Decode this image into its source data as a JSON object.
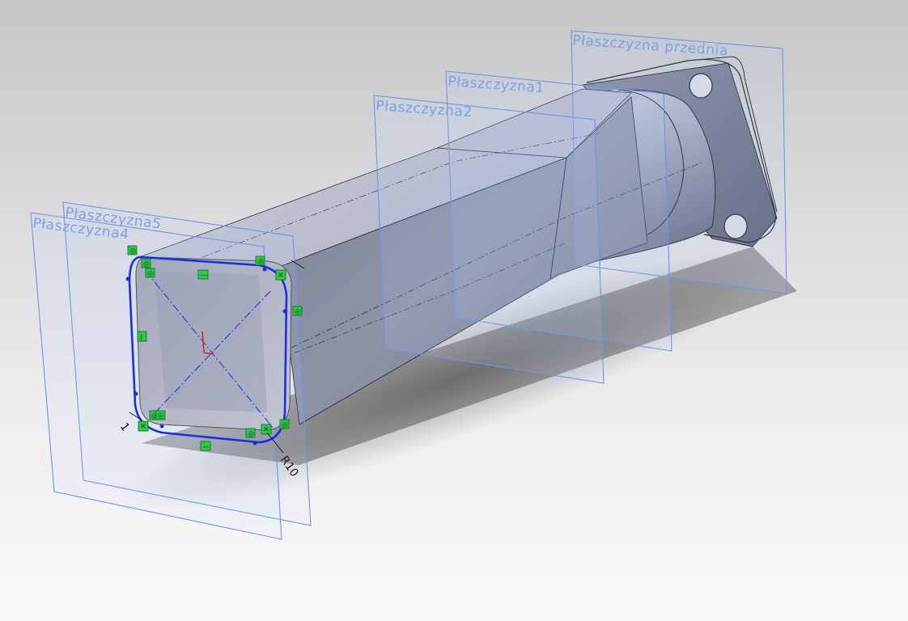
{
  "viewport": {
    "background_top": "#c4c6c8",
    "background_bottom": "#fafafa",
    "model_color": "#9ea3b5",
    "plane_color": "#6f93ea",
    "sketch_color": "#1a2fe0",
    "relation_color": "#2dc84a"
  },
  "planes": [
    {
      "id": "front",
      "label": "Płaszczyzna przednia"
    },
    {
      "id": "plane1",
      "label": "Płaszczyzna1"
    },
    {
      "id": "plane2",
      "label": "Płaszczyzna2"
    },
    {
      "id": "plane5",
      "label": "Płaszczyzna5"
    },
    {
      "id": "plane4",
      "label": "Płaszczyzna4"
    }
  ],
  "sketch": {
    "dimension_radius": "R10",
    "dimension_leader": "1",
    "relations": [
      "tangent",
      "horizontal",
      "vertical",
      "coincident"
    ]
  }
}
